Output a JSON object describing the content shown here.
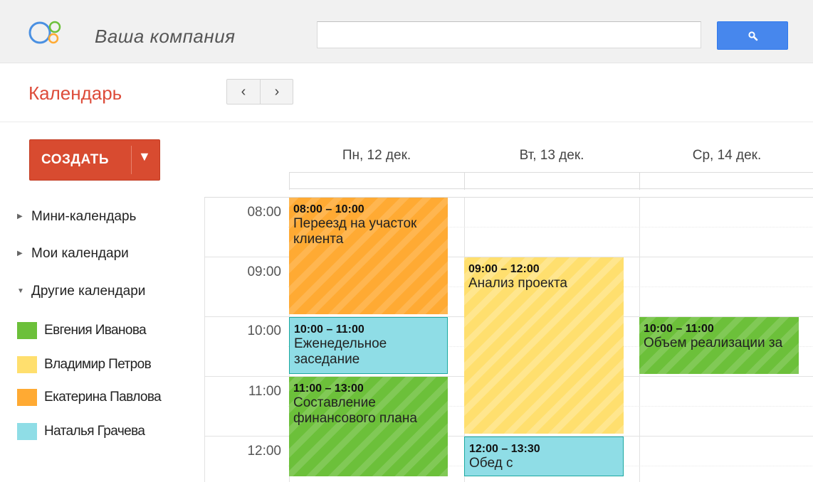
{
  "header": {
    "company_name": "Ваша компания",
    "search": {
      "value": "",
      "placeholder": ""
    },
    "search_icon": "magnifier-icon"
  },
  "app": {
    "title": "Календарь"
  },
  "nav": {
    "prev": "‹",
    "next": "›"
  },
  "create": {
    "label": "СОЗДАТЬ",
    "arrow": "▼"
  },
  "sidebar": {
    "sections": [
      {
        "label": "Мини-календарь",
        "expanded": false,
        "arrow": "▶"
      },
      {
        "label": "Мои календари",
        "expanded": false,
        "arrow": "▶"
      },
      {
        "label": "Другие календари",
        "expanded": true,
        "arrow": "▼"
      }
    ],
    "calendars": [
      {
        "name": "Евгения Иванова",
        "color": "#6cc03a"
      },
      {
        "name": "Владимир Петров",
        "color": "#ffdf6e"
      },
      {
        "name": "Екатерина Павлова",
        "color": "#ffaa33"
      },
      {
        "name": "Наталья Грачева",
        "color": "#8fdde6"
      }
    ]
  },
  "days": [
    {
      "label": "Пн, 12 дек."
    },
    {
      "label": "Вт, 13 дек."
    },
    {
      "label": "Ср, 14 дек."
    }
  ],
  "time_slots": [
    "08:00",
    "09:00",
    "10:00",
    "11:00",
    "12:00"
  ],
  "events": [
    {
      "time": "08:00 – 10:00",
      "title": "Переезд на участок клиента",
      "owner": "Екатерина Павлова",
      "color": "#ffaa33"
    },
    {
      "time": "09:00 – 12:00",
      "title": "Анализ проекта",
      "owner": "Владимир Петров",
      "color": "#ffdf6e"
    },
    {
      "time": "10:00 – 11:00",
      "title": "Еженедельное заседание",
      "owner": "Наталья Грачева",
      "color": "#8fdde6"
    },
    {
      "time": "10:00 – 11:00",
      "title": "Объем реализации за",
      "owner": "Евгения Иванова",
      "color": "#6cc03a"
    },
    {
      "time": "11:00 – 13:00",
      "title": "Составление финансового плана",
      "owner": "Евгения Иванова",
      "color": "#6cc03a"
    },
    {
      "time": "12:00 – 13:30",
      "title": "Обед с",
      "owner": "Наталья Грачева",
      "color": "#8fdde6"
    }
  ]
}
